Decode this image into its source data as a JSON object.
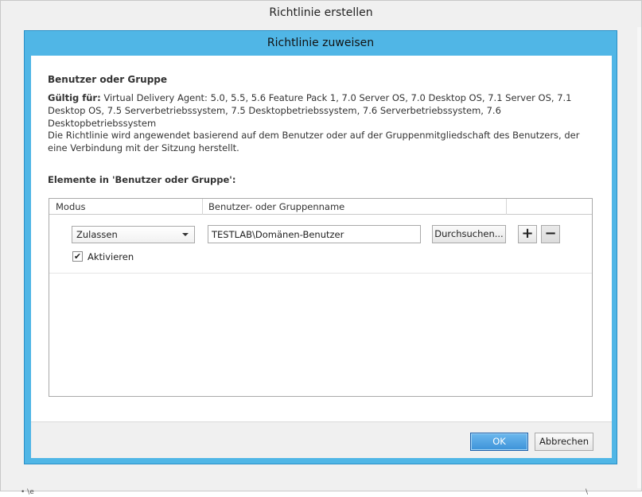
{
  "outer_window": {
    "title": "Richtlinie erstellen",
    "bottom_fragments": [
      "• \\e",
      "\\"
    ]
  },
  "dialog": {
    "title": "Richtlinie zuweisen",
    "section_title": "Benutzer oder Gruppe",
    "valid_for_label": "Gültig für:",
    "valid_for_text": "Virtual Delivery Agent: 5.0, 5.5, 5.6 Feature Pack 1, 7.0 Server OS, 7.0 Desktop OS, 7.1 Server OS, 7.1 Desktop OS, 7.5 Serverbetriebssystem, 7.5 Desktopbetriebssystem, 7.6 Serverbetriebssystem, 7.6 Desktopbetriebssystem",
    "description": "Die Richtlinie wird angewendet basierend auf dem Benutzer oder auf der Gruppenmitgliedschaft des Benutzers, der eine Verbindung mit der Sitzung herstellt.",
    "elements_label": "Elemente in 'Benutzer oder Gruppe':",
    "grid": {
      "columns": [
        "Modus",
        "Benutzer- oder Gruppenname",
        ""
      ],
      "rows": [
        {
          "mode": "Zulassen",
          "name": "TESTLAB\\Domänen-Benutzer",
          "browse_label": "Durchsuchen...",
          "add_label": "+",
          "remove_label": "−",
          "enable_label": "Aktivieren",
          "enabled": true,
          "check_glyph": "✔"
        }
      ]
    },
    "footer": {
      "ok_label": "OK",
      "cancel_label": "Abbrechen"
    }
  },
  "colors": {
    "dialog_frame": "#50b6e6",
    "ok_button": "#3d93d9"
  }
}
